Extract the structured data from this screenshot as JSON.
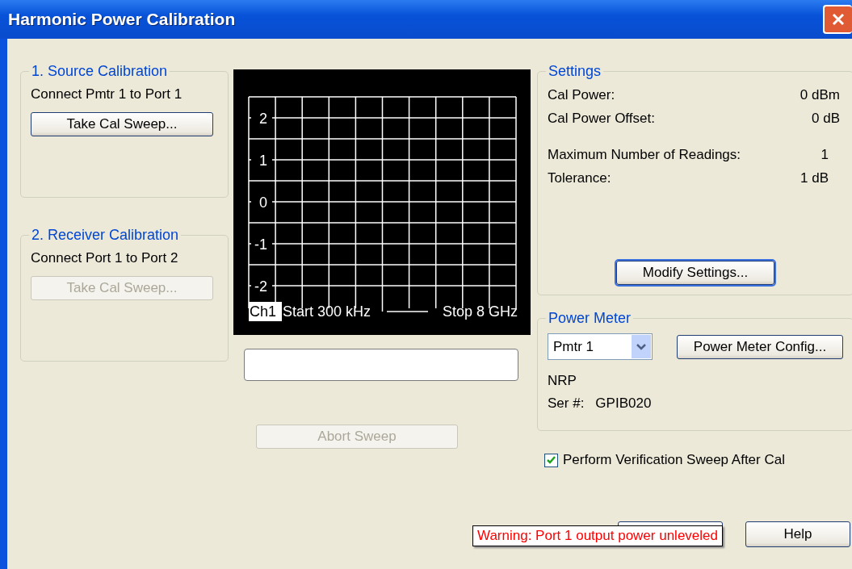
{
  "window": {
    "title": "Harmonic Power Calibration"
  },
  "source_calibration": {
    "title": "1. Source Calibration",
    "instruction": "Connect Pmtr 1 to Port 1",
    "button": {
      "label": "Take Cal Sweep...",
      "disabled": false
    }
  },
  "receiver_calibration": {
    "title": "2. Receiver Calibration",
    "instruction": "Connect Port 1 to Port 2",
    "button": {
      "label": "Take Cal Sweep...",
      "disabled": true
    }
  },
  "trace_display": {
    "y_labels": [
      "2",
      "1",
      "0",
      "-1",
      "-2"
    ],
    "channel": "Ch1",
    "start": "Start 300 kHz",
    "stop": "Stop 8 GHz"
  },
  "abort_button": {
    "label": "Abort Sweep",
    "disabled": true
  },
  "settings": {
    "title": "Settings",
    "rows": [
      {
        "label": "Cal Power:",
        "value": "0 dBm"
      },
      {
        "label": "Cal Power Offset:",
        "value": "0 dB"
      },
      {
        "label": "Maximum Number of Readings:",
        "value": "1"
      },
      {
        "label": "Tolerance:",
        "value": "1 dB"
      }
    ],
    "button": "Modify Settings..."
  },
  "power_meter": {
    "title": "Power Meter",
    "select": "Pmtr 1",
    "config_button": "Power Meter Config...",
    "model": "NRP",
    "serial_label": "Ser #:",
    "serial": "GPIB020"
  },
  "verification": {
    "label": "Perform Verification Sweep After Cal",
    "checked": true
  },
  "bottom_buttons": [
    {
      "kind": "covered"
    },
    {
      "kind": "plain",
      "label": "Help"
    }
  ],
  "tooltip": "Warning: Port 1 output power unleveled"
}
